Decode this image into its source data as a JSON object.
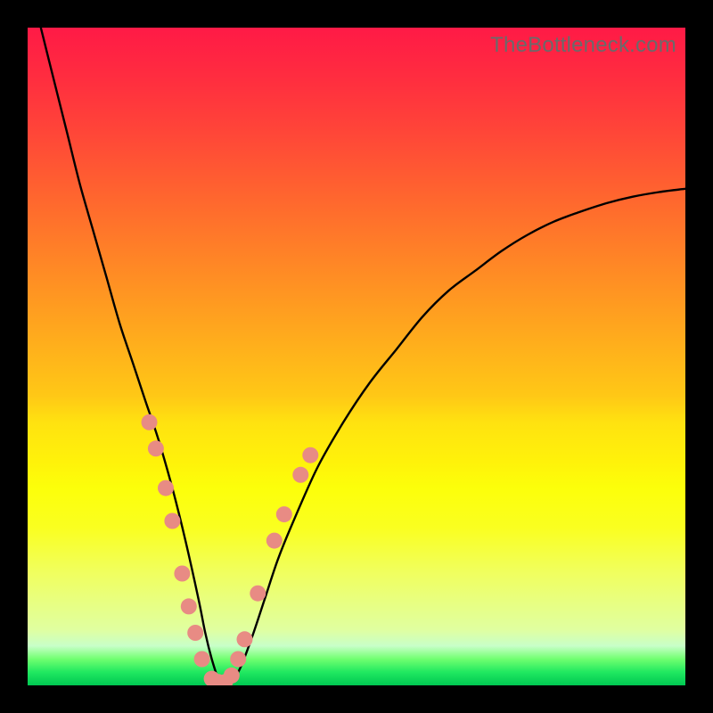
{
  "watermark": "TheBottleneck.com",
  "colors": {
    "frame": "#000000",
    "dot": "#e88b84",
    "curve": "#000000"
  },
  "chart_data": {
    "type": "line",
    "title": "",
    "xlabel": "",
    "ylabel": "",
    "xlim": [
      0,
      100
    ],
    "ylim": [
      0,
      100
    ],
    "annotations": [
      {
        "text": "TheBottleneck.com",
        "position": "top-right"
      }
    ],
    "series": [
      {
        "name": "bottleneck-curve",
        "x": [
          2,
          4,
          6,
          8,
          10,
          12,
          14,
          16,
          18,
          20,
          22,
          24,
          26,
          27,
          28,
          29,
          30,
          32,
          34,
          36,
          38,
          40,
          44,
          48,
          52,
          56,
          60,
          64,
          68,
          72,
          76,
          80,
          84,
          88,
          92,
          96,
          100
        ],
        "y": [
          100,
          92,
          84,
          76,
          69,
          62,
          55,
          49,
          43,
          37,
          30,
          22,
          13,
          8,
          4,
          1,
          0,
          2,
          7,
          13,
          19,
          24,
          33,
          40,
          46,
          51,
          56,
          60,
          63,
          66,
          68.5,
          70.5,
          72,
          73.3,
          74.3,
          75,
          75.5
        ]
      }
    ],
    "scatter_overlay": {
      "name": "data-points",
      "points": [
        {
          "x": 18.5,
          "y": 40
        },
        {
          "x": 19.5,
          "y": 36
        },
        {
          "x": 21.0,
          "y": 30
        },
        {
          "x": 22.0,
          "y": 25
        },
        {
          "x": 23.5,
          "y": 17
        },
        {
          "x": 24.5,
          "y": 12
        },
        {
          "x": 25.5,
          "y": 8
        },
        {
          "x": 26.5,
          "y": 4
        },
        {
          "x": 28.0,
          "y": 1
        },
        {
          "x": 29.0,
          "y": 0.5
        },
        {
          "x": 30.0,
          "y": 0.5
        },
        {
          "x": 31.0,
          "y": 1.5
        },
        {
          "x": 32.0,
          "y": 4
        },
        {
          "x": 33.0,
          "y": 7
        },
        {
          "x": 35.0,
          "y": 14
        },
        {
          "x": 37.5,
          "y": 22
        },
        {
          "x": 39.0,
          "y": 26
        },
        {
          "x": 41.5,
          "y": 32
        },
        {
          "x": 43.0,
          "y": 35
        }
      ]
    }
  }
}
